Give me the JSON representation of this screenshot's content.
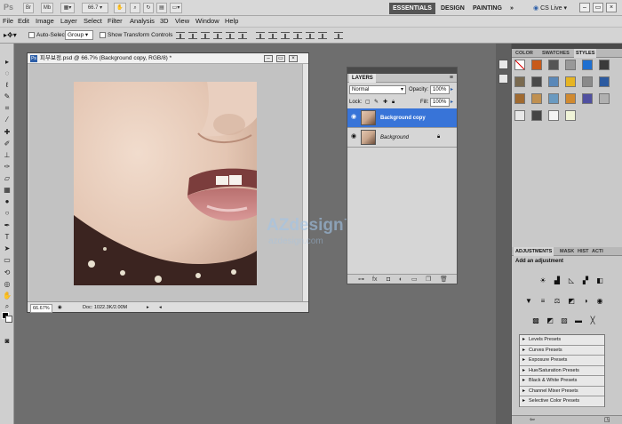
{
  "appbar": {
    "zoom": "66.7",
    "workspaces": [
      "ESSENTIALS",
      "DESIGN",
      "PAINTING"
    ],
    "more": "»",
    "cs_live": "CS Live"
  },
  "menus": [
    "File",
    "Edit",
    "Image",
    "Layer",
    "Select",
    "Filter",
    "Analysis",
    "3D",
    "View",
    "Window",
    "Help"
  ],
  "options": {
    "auto_select_label": "Auto-Select:",
    "auto_select_value": "Group",
    "show_transform_label": "Show Transform Controls"
  },
  "document": {
    "title": "피부보정.psd @ 66.7% (Background copy, RGB/8) *",
    "zoom_field": "66.67%",
    "doc_info": "Doc: 1022.3K/2.00M"
  },
  "watermark": {
    "main": "AZdesign™",
    "sub": "azdesign.com"
  },
  "layers_panel": {
    "tab": "LAYERS",
    "blend_mode": "Normal",
    "opacity_label": "Opacity:",
    "opacity_value": "100%",
    "lock_label": "Lock:",
    "fill_label": "Fill:",
    "fill_value": "100%",
    "layers": [
      {
        "name": "Background copy",
        "selected": true
      },
      {
        "name": "Background",
        "selected": false
      }
    ]
  },
  "top_right_panel": {
    "tabs": [
      "COLOR",
      "SWATCHES",
      "STYLES"
    ],
    "active_tab": "STYLES"
  },
  "adjustments_panel": {
    "tabs": [
      "ADJUSTMENTS",
      "MASK",
      "HIST",
      "ACTI"
    ],
    "heading": "Add an adjustment",
    "presets": [
      "Levels Presets",
      "Curves Presets",
      "Exposure Presets",
      "Hue/Saturation Presets",
      "Black & White Presets",
      "Channel Mixer Presets",
      "Selective Color Presets"
    ]
  },
  "colors": {
    "accent_selected": "#3874d8",
    "workspace_active": "#555555"
  }
}
